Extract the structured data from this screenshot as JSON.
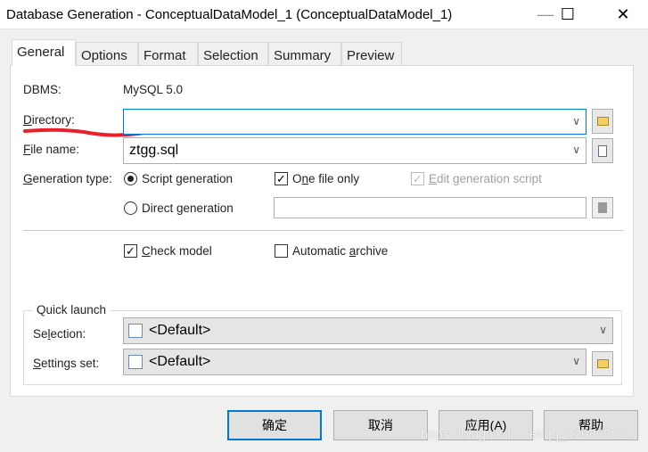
{
  "window": {
    "title": "Database Generation - ConceptualDataModel_1 (ConceptualDataModel_1)",
    "minimize": "—",
    "maximize": "☐",
    "close": "✕"
  },
  "tabs": [
    {
      "label": "General",
      "active": true
    },
    {
      "label": "Options"
    },
    {
      "label": "Format"
    },
    {
      "label": "Selection"
    },
    {
      "label": "Summary"
    },
    {
      "label": "Preview"
    }
  ],
  "general": {
    "dbms_label": "DBMS:",
    "dbms_value": "MySQL 5.0",
    "directory_label_u": "D",
    "directory_label_rest": "irectory:",
    "directory_value": "",
    "filename_label_u": "F",
    "filename_label_rest": "ile name:",
    "filename_value": "ztgg.sql",
    "gentype_label_u": "G",
    "gentype_label_rest": "eneration type:",
    "script_generation": "Script generation",
    "script_selected": true,
    "direct_generation": "Direct generation",
    "one_file_pre": "O",
    "one_file_u": "n",
    "one_file_rest": "e file only",
    "one_file_checked": true,
    "edit_script_u": "E",
    "edit_script_rest": "dit generation script",
    "edit_script_checked": true,
    "edit_script_disabled": true,
    "direct_value": "",
    "check_model_u": "C",
    "check_model_rest": "heck model",
    "check_model_checked": true,
    "auto_archive_pre": "Automatic ",
    "auto_archive_u": "a",
    "auto_archive_rest": "rchive",
    "auto_archive_checked": false
  },
  "quick_launch": {
    "title": "Quick launch",
    "selection_pre": "Se",
    "selection_u": "l",
    "selection_rest": "ection:",
    "selection_value": "<Default>",
    "settings_u": "S",
    "settings_rest": "ettings set:",
    "settings_value": "<Default>"
  },
  "buttons": {
    "ok": "确定",
    "cancel": "取消",
    "apply": "应用(A)",
    "help": "帮助"
  },
  "watermark": "https://blog.csdn.net/qq_42983502",
  "colors": {
    "focus": "#0078d7",
    "annotation": "#e8202a"
  }
}
